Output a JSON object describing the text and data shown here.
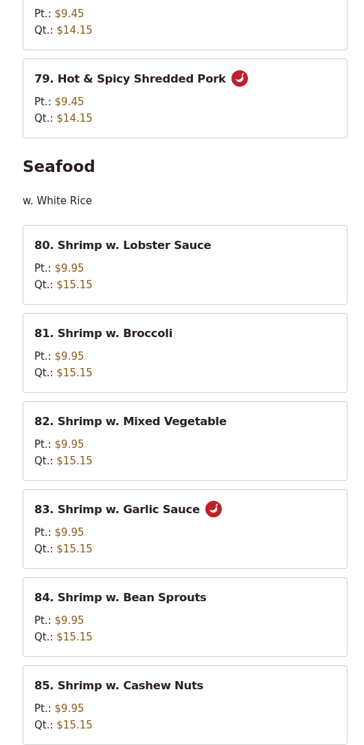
{
  "continued_item": {
    "prices": [
      {
        "label": "Pt.:",
        "price": "$9.45"
      },
      {
        "label": "Qt.:",
        "price": "$14.15"
      }
    ]
  },
  "items_before": [
    {
      "name": "79. Hot & Spicy Shredded Pork",
      "spicy": true,
      "prices": [
        {
          "label": "Pt.:",
          "price": "$9.45"
        },
        {
          "label": "Qt.:",
          "price": "$14.15"
        }
      ]
    }
  ],
  "section": {
    "title": "Seafood",
    "subtitle": "w. White Rice",
    "items": [
      {
        "name": "80. Shrimp w. Lobster Sauce",
        "spicy": false,
        "prices": [
          {
            "label": "Pt.:",
            "price": "$9.95"
          },
          {
            "label": "Qt.:",
            "price": "$15.15"
          }
        ]
      },
      {
        "name": "81. Shrimp w. Broccoli",
        "spicy": false,
        "prices": [
          {
            "label": "Pt.:",
            "price": "$9.95"
          },
          {
            "label": "Qt.:",
            "price": "$15.15"
          }
        ]
      },
      {
        "name": "82. Shrimp w. Mixed Vegetable",
        "spicy": false,
        "prices": [
          {
            "label": "Pt.:",
            "price": "$9.95"
          },
          {
            "label": "Qt.:",
            "price": "$15.15"
          }
        ]
      },
      {
        "name": "83. Shrimp w. Garlic Sauce",
        "spicy": true,
        "prices": [
          {
            "label": "Pt.:",
            "price": "$9.95"
          },
          {
            "label": "Qt.:",
            "price": "$15.15"
          }
        ]
      },
      {
        "name": "84. Shrimp w. Bean Sprouts",
        "spicy": false,
        "prices": [
          {
            "label": "Pt.:",
            "price": "$9.95"
          },
          {
            "label": "Qt.:",
            "price": "$15.15"
          }
        ]
      },
      {
        "name": "85. Shrimp w. Cashew Nuts",
        "spicy": false,
        "prices": [
          {
            "label": "Pt.:",
            "price": "$9.95"
          },
          {
            "label": "Qt.:",
            "price": "$15.15"
          }
        ]
      }
    ]
  }
}
